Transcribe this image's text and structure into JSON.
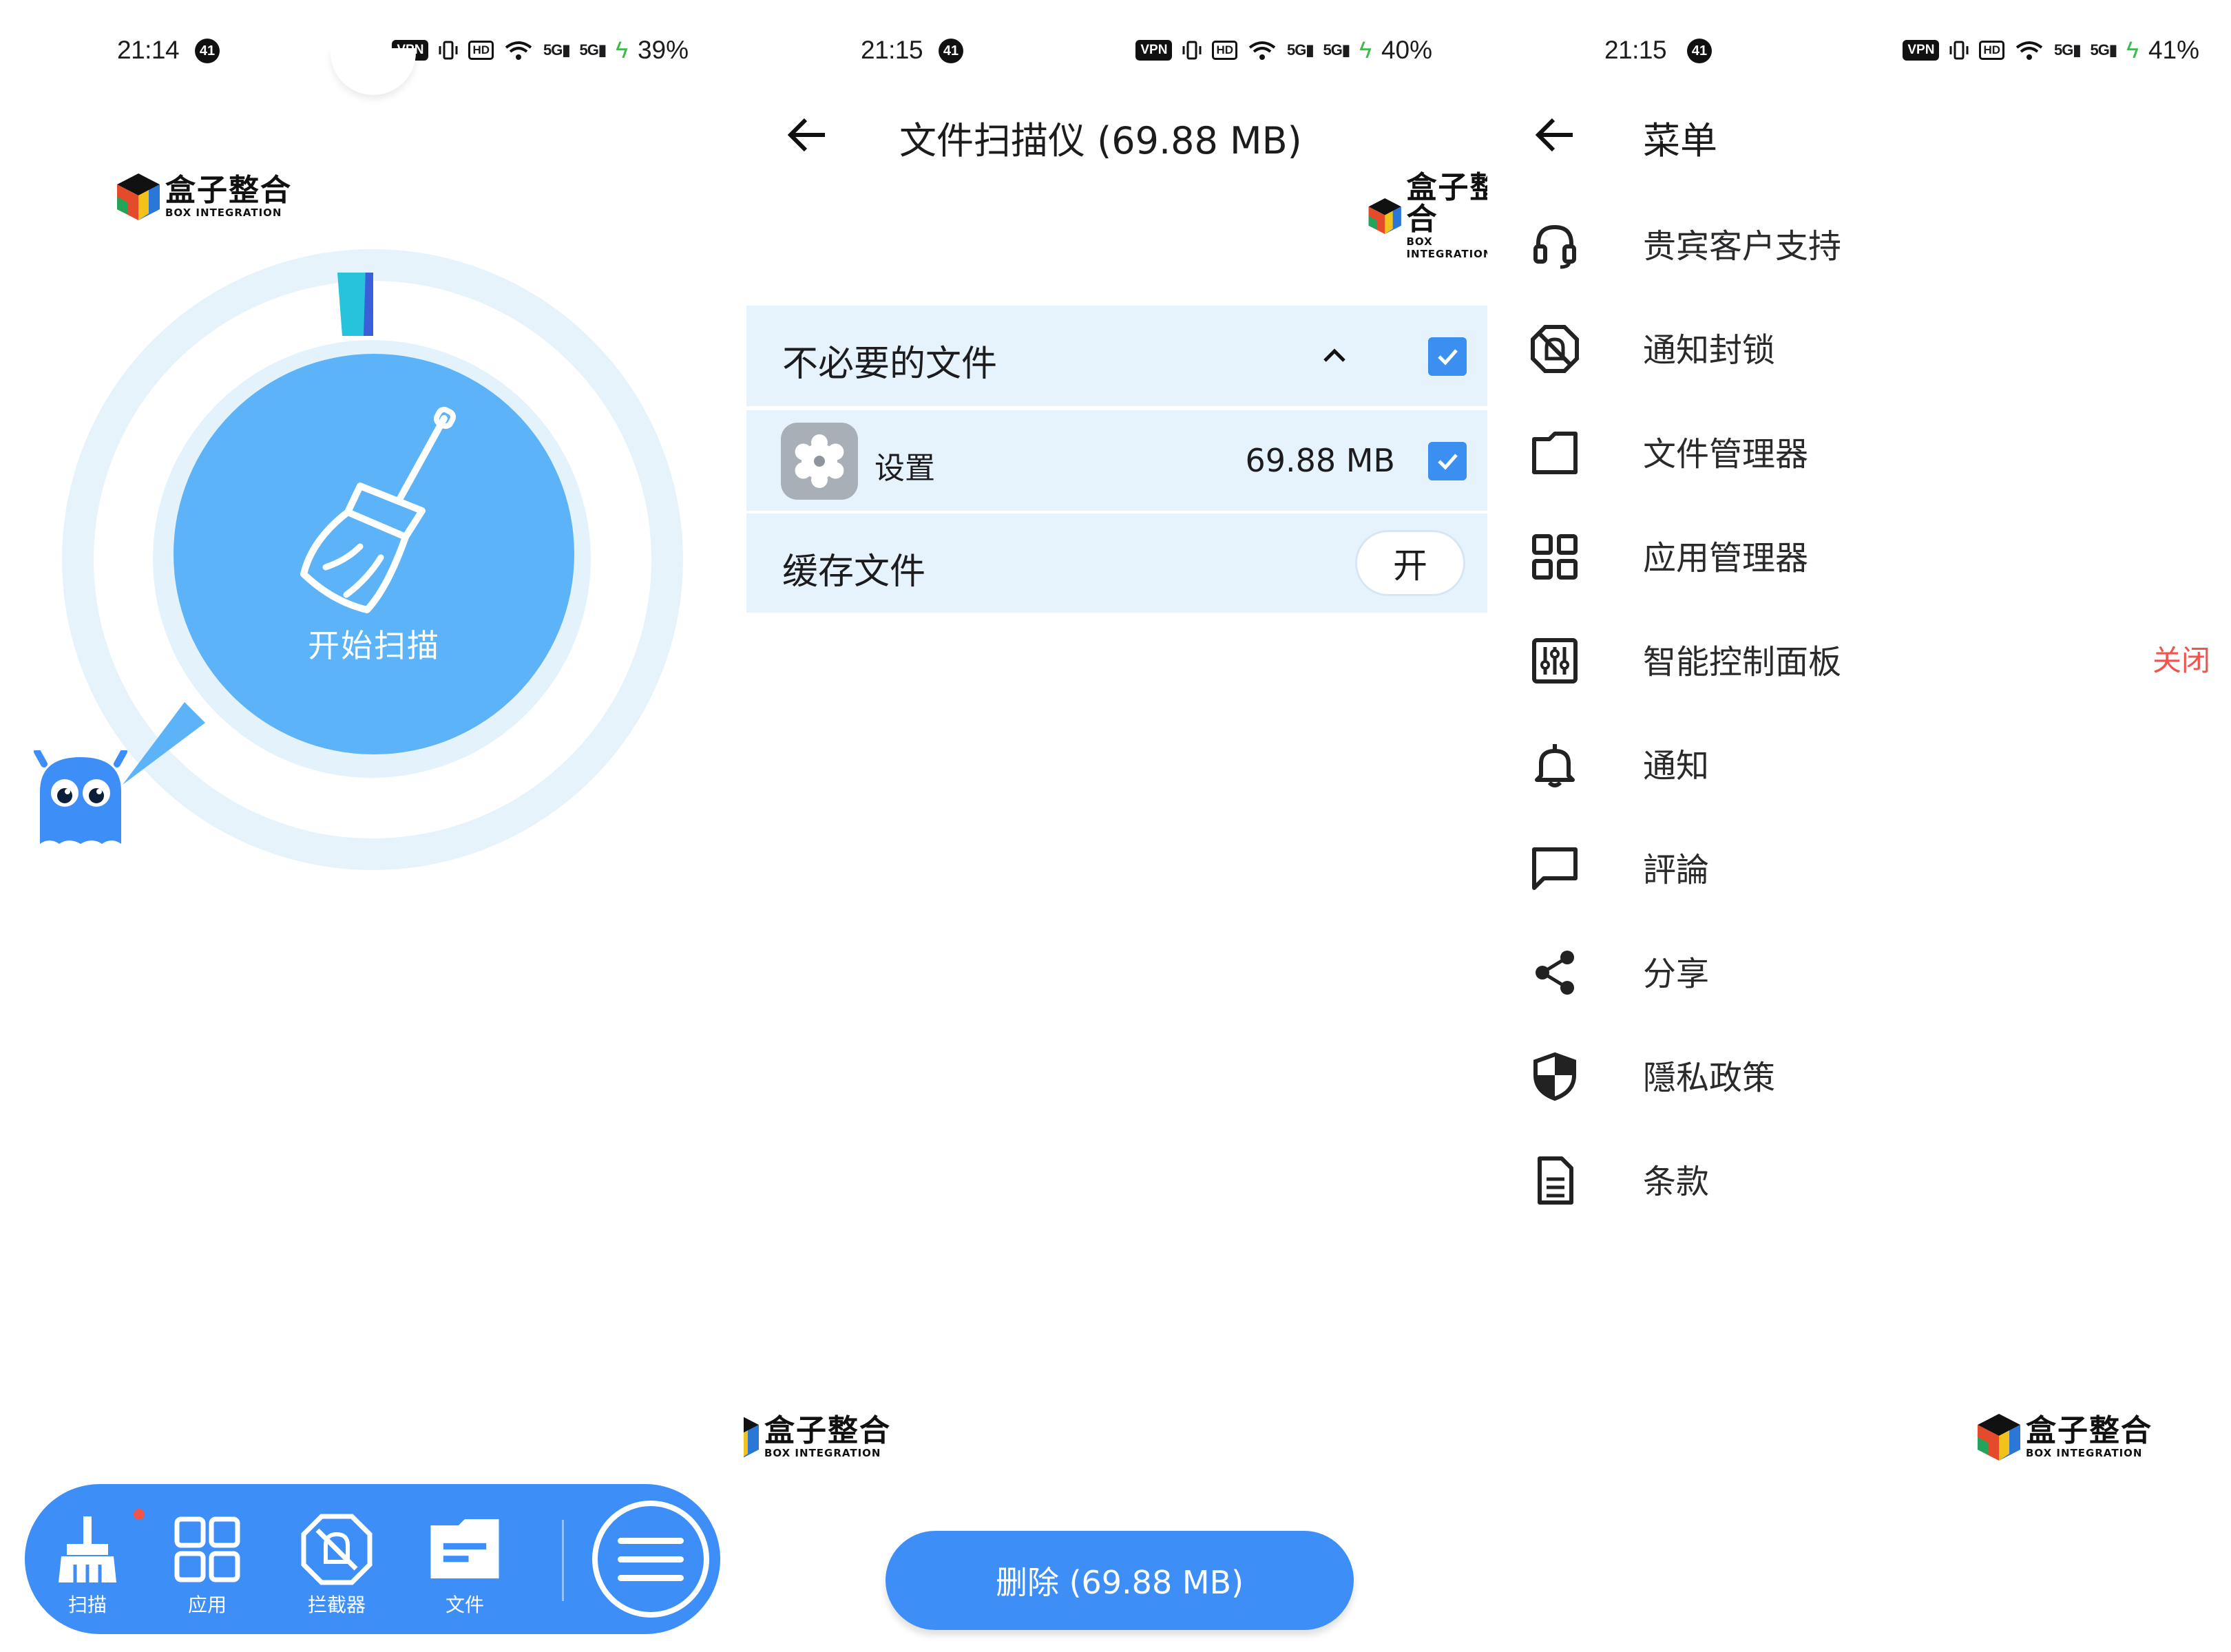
{
  "panels": [
    {
      "status": {
        "time": "21:14",
        "badge": "41",
        "vpn": "VPN",
        "hd": "HD",
        "net1": "5G",
        "net2": "5G",
        "battery": "39%"
      },
      "scan_button_label": "开始扫描",
      "bottom_nav": {
        "items": [
          {
            "label": "扫描",
            "icon": "broom-icon"
          },
          {
            "label": "应用",
            "icon": "grid-icon"
          },
          {
            "label": "拦截器",
            "icon": "blocker-icon"
          },
          {
            "label": "文件",
            "icon": "folder-icon"
          }
        ],
        "menu_icon": "menu-icon"
      }
    },
    {
      "status": {
        "time": "21:15",
        "badge": "41",
        "vpn": "VPN",
        "hd": "HD",
        "net1": "5G",
        "net2": "5G",
        "battery": "40%"
      },
      "title": "文件扫描仪 (69.88 MB)",
      "unnecessary_files": {
        "label": "不必要的文件",
        "checked": true
      },
      "app_entry": {
        "name": "设置",
        "size": "69.88 MB",
        "checked": true
      },
      "cache": {
        "label": "缓存文件",
        "toggle_label": "开"
      },
      "delete_button": "删除 (69.88 MB)"
    },
    {
      "status": {
        "time": "21:15",
        "badge": "41",
        "vpn": "VPN",
        "hd": "HD",
        "net1": "5G",
        "net2": "5G",
        "battery": "41%"
      },
      "title": "菜单",
      "menu_items": [
        {
          "label": "贵宾客户支持",
          "icon": "headset-icon"
        },
        {
          "label": "通知封锁",
          "icon": "notification-block-icon"
        },
        {
          "label": "文件管理器",
          "icon": "folder-outline-icon"
        },
        {
          "label": "应用管理器",
          "icon": "grid-outline-icon"
        },
        {
          "label": "智能控制面板",
          "icon": "sliders-icon",
          "value": "关闭"
        },
        {
          "label": "通知",
          "icon": "bell-icon"
        },
        {
          "label": "評論",
          "icon": "comment-icon"
        },
        {
          "label": "分享",
          "icon": "share-icon"
        },
        {
          "label": "隱私政策",
          "icon": "shield-icon"
        },
        {
          "label": "条款",
          "icon": "document-icon"
        }
      ]
    }
  ],
  "watermark": {
    "cn": "盒子整合",
    "en": "BOX INTEGRATION"
  },
  "colors": {
    "accent": "#3d8ff7",
    "scan_circle": "#5cb3f7",
    "row_bg": "#e6f2fc",
    "off_text": "#f0544c"
  }
}
